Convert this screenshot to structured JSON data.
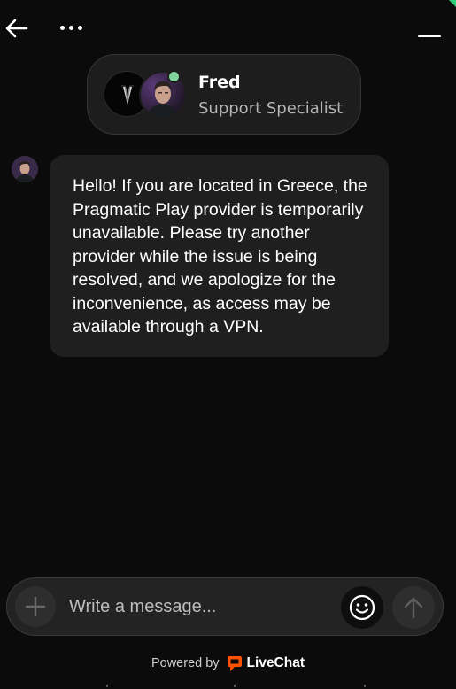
{
  "theme": {
    "background": "#0b0b0b",
    "card": "#1d1d1d",
    "bubble": "#1f1f1f",
    "online": "#7fd49b",
    "brand": "#ff5100",
    "accent": "#2fd07a"
  },
  "header": {
    "back_icon": "arrow-left-icon",
    "more_icon": "more-horizontal-icon",
    "minimize_icon": "minimize-icon"
  },
  "agent": {
    "name": "Fred",
    "role": "Support Specialist",
    "status": "online"
  },
  "messages": [
    {
      "author": "Fred",
      "text": "Hello! If you are located in Greece, the Pragmatic Play provider is temporarily unavailable. Please try another provider while the issue is being resolved, and we apologize for the inconvenience, as access may be available through a VPN."
    }
  ],
  "composer": {
    "placeholder": "Write a message...",
    "value": "",
    "attach_icon": "plus-icon",
    "emoji_icon": "smiley-icon",
    "send_icon": "arrow-up-icon"
  },
  "footer": {
    "powered_by": "Powered by",
    "brand": "LiveChat"
  }
}
